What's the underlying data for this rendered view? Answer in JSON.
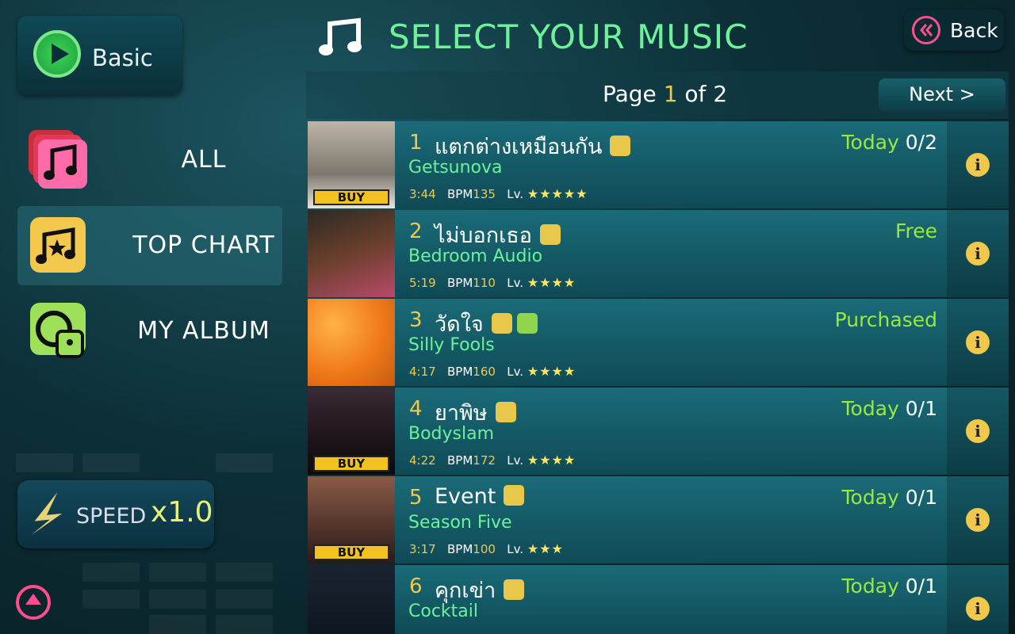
{
  "header": {
    "title": "SELECT YOUR MUSIC",
    "back_label": "Back"
  },
  "mode": {
    "label": "Basic"
  },
  "categories": [
    {
      "label": "ALL",
      "icon": "music-note-stack-icon"
    },
    {
      "label": "TOP CHART",
      "icon": "music-star-icon"
    },
    {
      "label": "MY ALBUM",
      "icon": "album-lock-icon"
    }
  ],
  "speed": {
    "label": "SPEED",
    "value": "x1.0"
  },
  "pagination": {
    "prefix": "Page ",
    "current": "1",
    "middle": " of ",
    "total": "2",
    "next_label": "Next >"
  },
  "songs": [
    {
      "num": "1",
      "title": "แตกต่างเหมือนกัน",
      "artist": "Getsunova",
      "duration": "3:44",
      "bpm_label": "BPM",
      "bpm": "135",
      "level_label": "Lv.",
      "stars": "★★★★★",
      "status_label": "Today ",
      "status_value": "0/2",
      "buy": "BUY"
    },
    {
      "num": "2",
      "title": "ไม่บอกเธอ",
      "artist": "Bedroom Audio",
      "duration": "5:19",
      "bpm_label": "BPM",
      "bpm": "110",
      "level_label": "Lv.",
      "stars": "★★★★",
      "status_label": "Free",
      "status_value": "",
      "buy": ""
    },
    {
      "num": "3",
      "title": "วัดใจ",
      "artist": "Silly Fools",
      "duration": "4:17",
      "bpm_label": "BPM",
      "bpm": "160",
      "level_label": "Lv.",
      "stars": "★★★★",
      "status_label": "Purchased",
      "status_value": "",
      "buy": ""
    },
    {
      "num": "4",
      "title": "ยาพิษ",
      "artist": "Bodyslam",
      "duration": "4:22",
      "bpm_label": "BPM",
      "bpm": "172",
      "level_label": "Lv.",
      "stars": "★★★★",
      "status_label": "Today ",
      "status_value": "0/1",
      "buy": "BUY"
    },
    {
      "num": "5",
      "title": "Event",
      "artist": "Season Five",
      "duration": "3:17",
      "bpm_label": "BPM",
      "bpm": "100",
      "level_label": "Lv.",
      "stars": "★★★",
      "status_label": "Today ",
      "status_value": "0/1",
      "buy": "BUY"
    },
    {
      "num": "6",
      "title": "คุกเข่า",
      "artist": "Cocktail",
      "duration": "",
      "bpm_label": "",
      "bpm": "",
      "level_label": "",
      "stars": "",
      "status_label": "Today ",
      "status_value": "0/1",
      "buy": ""
    }
  ],
  "info_glyph": "i",
  "colors": {
    "title": "#6df29a",
    "accent_yellow": "#f1c94a",
    "status_green": "#98ea3c",
    "back_pink": "#ff4d8d"
  }
}
